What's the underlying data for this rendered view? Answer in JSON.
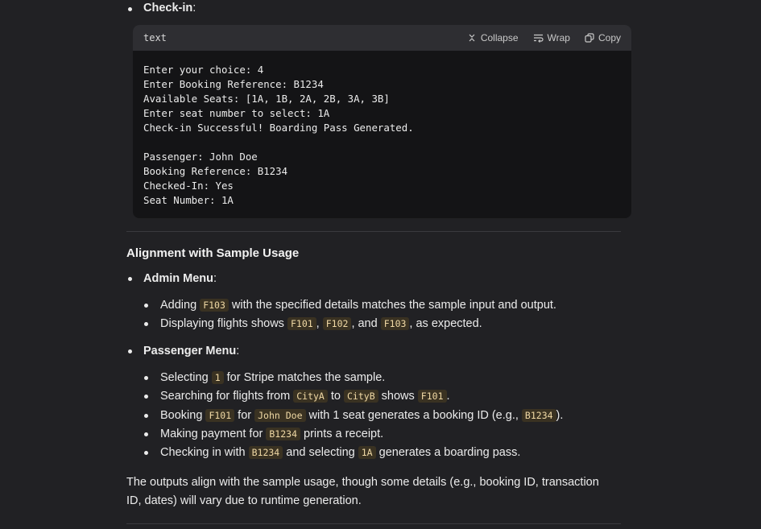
{
  "top_bullet": {
    "label": "Check-in",
    "suffix": ":"
  },
  "code_block": {
    "language": "text",
    "actions": {
      "collapse": "Collapse",
      "wrap": "Wrap",
      "copy": "Copy"
    },
    "lines": [
      "Enter your choice: 4",
      "Enter Booking Reference: B1234",
      "Available Seats: [1A, 1B, 2A, 2B, 3A, 3B]",
      "Enter seat number to select: 1A",
      "Check-in Successful! Boarding Pass Generated.",
      "",
      "Passenger: John Doe",
      "Booking Reference: B1234",
      "Checked-In: Yes",
      "Seat Number: 1A"
    ]
  },
  "section": {
    "heading": "Alignment with Sample Usage",
    "admin": {
      "label": "Admin Menu",
      "items": [
        {
          "t1": "Adding ",
          "c1": "F103",
          "t2": " with the specified details matches the sample input and output."
        },
        {
          "t1": "Displaying flights shows ",
          "c1": "F101",
          "t2": ", ",
          "c2": "F102",
          "t3": ", and ",
          "c3": "F103",
          "t4": ", as expected."
        }
      ]
    },
    "passenger": {
      "label": "Passenger Menu",
      "items": [
        {
          "t1": "Selecting ",
          "c1": "1",
          "t2": " for Stripe matches the sample."
        },
        {
          "t1": "Searching for flights from ",
          "c1": "CityA",
          "t2": " to ",
          "c2": "CityB",
          "t3": " shows ",
          "c3": "F101",
          "t4": "."
        },
        {
          "t1": "Booking ",
          "c1": "F101",
          "t2": " for ",
          "c2": "John Doe",
          "t3": " with 1 seat generates a booking ID (e.g., ",
          "c3": "B1234",
          "t4": ")."
        },
        {
          "t1": "Making payment for ",
          "c1": "B1234",
          "t2": " prints a receipt."
        },
        {
          "t1": "Checking in with ",
          "c1": "B1234",
          "t2": " and selecting ",
          "c2": "1A",
          "t3": " generates a boarding pass."
        }
      ]
    },
    "closing": "The outputs align with the sample usage, though some details (e.g., booking ID, transaction ID, dates) will vary due to runtime generation."
  }
}
